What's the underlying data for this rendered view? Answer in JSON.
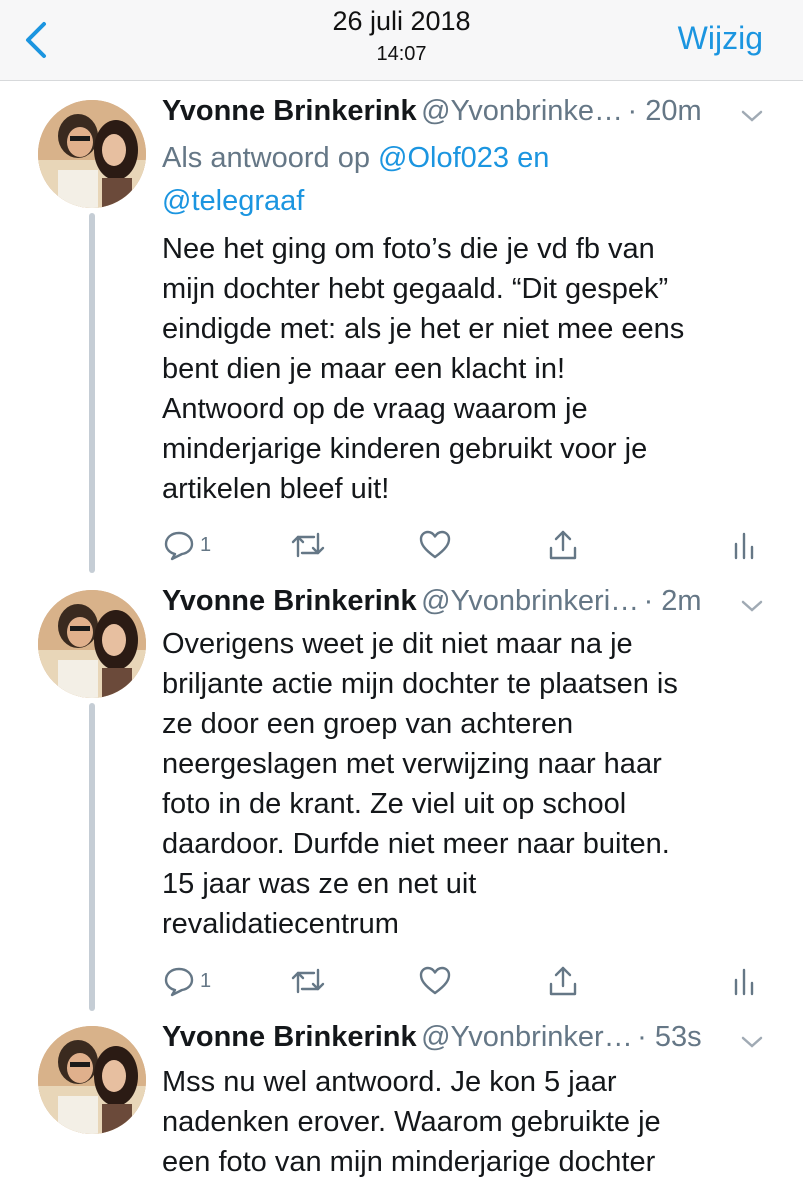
{
  "header": {
    "date": "26 juli 2018",
    "time": "14:07",
    "edit_label": "Wijzig"
  },
  "colors": {
    "accent": "#1b95e0",
    "secondary_text": "#657786",
    "thread_line": "#c5cdd5"
  },
  "tweets": [
    {
      "name": "Yvonne Brinkerink",
      "handle": "@Yvonbrinke…",
      "time": "· 20m",
      "reply_prefix": "Als antwoord op ",
      "reply_mention_1": "@Olof023",
      "reply_and": " en ",
      "reply_mention_2": "@telegraaf",
      "lines": [
        "Nee het ging om foto’s die je vd fb van",
        "mijn dochter hebt gegaald. “Dit gespek”",
        "eindigde met: als je het er niet mee eens",
        "bent dien je maar een klacht in!",
        "Antwoord op de vraag waarom je",
        "minderjarige kinderen gebruikt voor je",
        "artikelen bleef uit!"
      ],
      "reply_count": "1"
    },
    {
      "name": "Yvonne Brinkerink",
      "handle": "@Yvonbrinkeri…",
      "time": "· 2m",
      "lines": [
        "Overigens weet je dit niet maar na je",
        "briljante actie mijn dochter te plaatsen is",
        "ze door een groep van achteren",
        "neergeslagen met verwijzing naar haar",
        "foto in de krant. Ze viel uit op school",
        "daardoor. Durfde niet meer naar buiten.",
        "15 jaar was ze en net uit",
        "revalidatiecentrum"
      ],
      "reply_count": "1"
    },
    {
      "name": "Yvonne Brinkerink",
      "handle": "@Yvonbrinker…",
      "time": "· 53s",
      "lines": [
        "Mss nu wel antwoord. Je kon 5 jaar",
        "nadenken erover. Waarom gebruikte je",
        "een foto van mijn minderjarige dochter"
      ]
    }
  ],
  "icons": {
    "back": "chevron-left-icon",
    "caret": "chevron-down-icon",
    "reply": "reply-bubble-icon",
    "retweet": "retweet-icon",
    "like": "heart-icon",
    "share": "share-icon",
    "analytics": "analytics-bars-icon"
  }
}
